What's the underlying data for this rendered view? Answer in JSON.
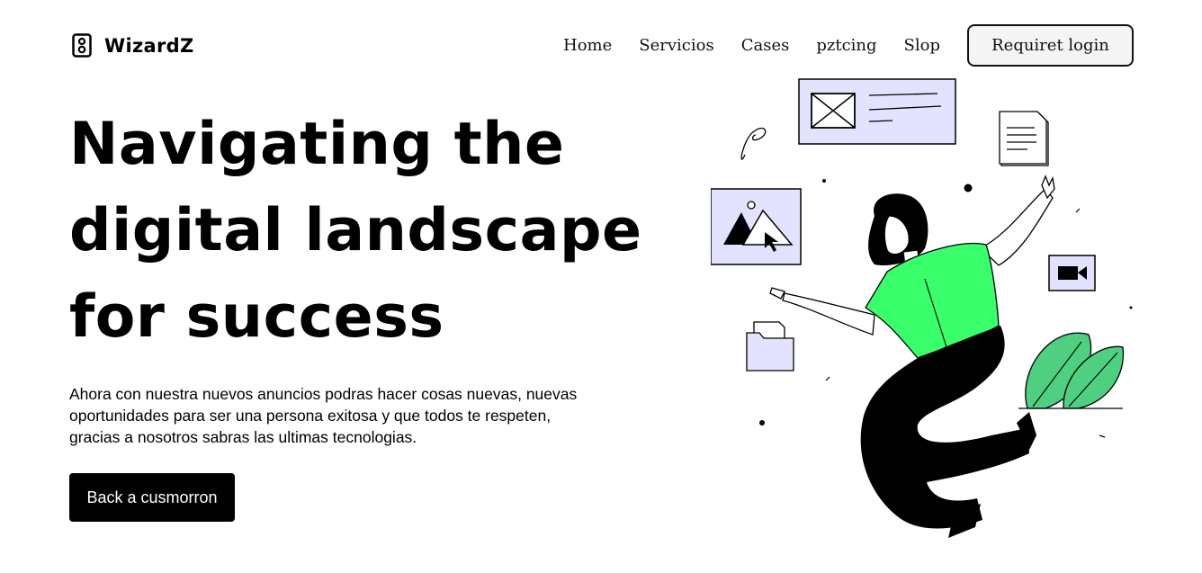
{
  "brand": {
    "name": "WizardZ",
    "icon": "speaker-icon"
  },
  "nav": {
    "links": [
      "Home",
      "Servicios",
      "Cases",
      "pztcing",
      "Slop"
    ],
    "login_label": "Requiret login"
  },
  "hero": {
    "title_lines": [
      "Navigating the",
      "digital landscape",
      "for success"
    ],
    "description_lines": [
      "Ahora con nuestra nuevos anuncios podras hacer cosas nuevas, nuevas",
      "oportunidades para ser una persona exitosa y que todos te respeten,",
      "gracias a nosotros sabras las ultimas tecnologias."
    ],
    "cta_label": "Back a cusmorron"
  },
  "illustration": {
    "subject": "woman-floating-with-digital-cards",
    "colors": {
      "accent_green": "#39ff6b",
      "card_lavender": "#e4e3ff",
      "plant_green": "#4fcf80",
      "ink": "#000000"
    }
  }
}
